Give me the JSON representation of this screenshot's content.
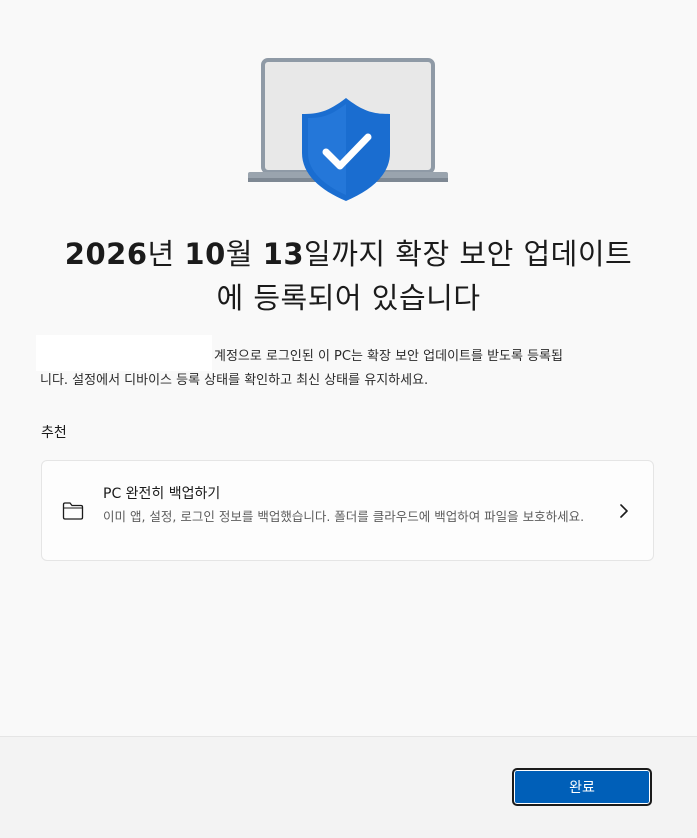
{
  "hero": {
    "icons": [
      "laptop-icon",
      "shield-check-icon"
    ]
  },
  "title": {
    "date_bold_1": "2026",
    "unit_1": "년 ",
    "date_bold_2": "10",
    "unit_2": "월 ",
    "date_bold_3": "13",
    "rest_line1": "일까지 확장 보안 업데이트",
    "line2": "에 등록되어 있습니다"
  },
  "description": {
    "line1": "계정으로 로그인된 이 PC는 확장 보안 업데이트를 받도록 등록됩",
    "line2": "니다. 설정에서 디바이스 등록 상태를 확인하고 최신 상태를 유지하세요."
  },
  "recommendation": {
    "section_label": "추천",
    "card": {
      "icon": "folder-icon",
      "title": "PC 완전히 백업하기",
      "description": "이미 앱, 설정, 로그인 정보를 백업했습니다. 폴더를 클라우드에 백업하여 파일을 보호하세요.",
      "chevron_icon": "chevron-right-icon"
    }
  },
  "footer": {
    "done_label": "완료"
  },
  "colors": {
    "background": "#f9f9f9",
    "accent": "#005fb8",
    "shield": "#1a6dd0",
    "laptop_screen": "#e6e6e6",
    "laptop_frame": "#8f9aa6"
  }
}
